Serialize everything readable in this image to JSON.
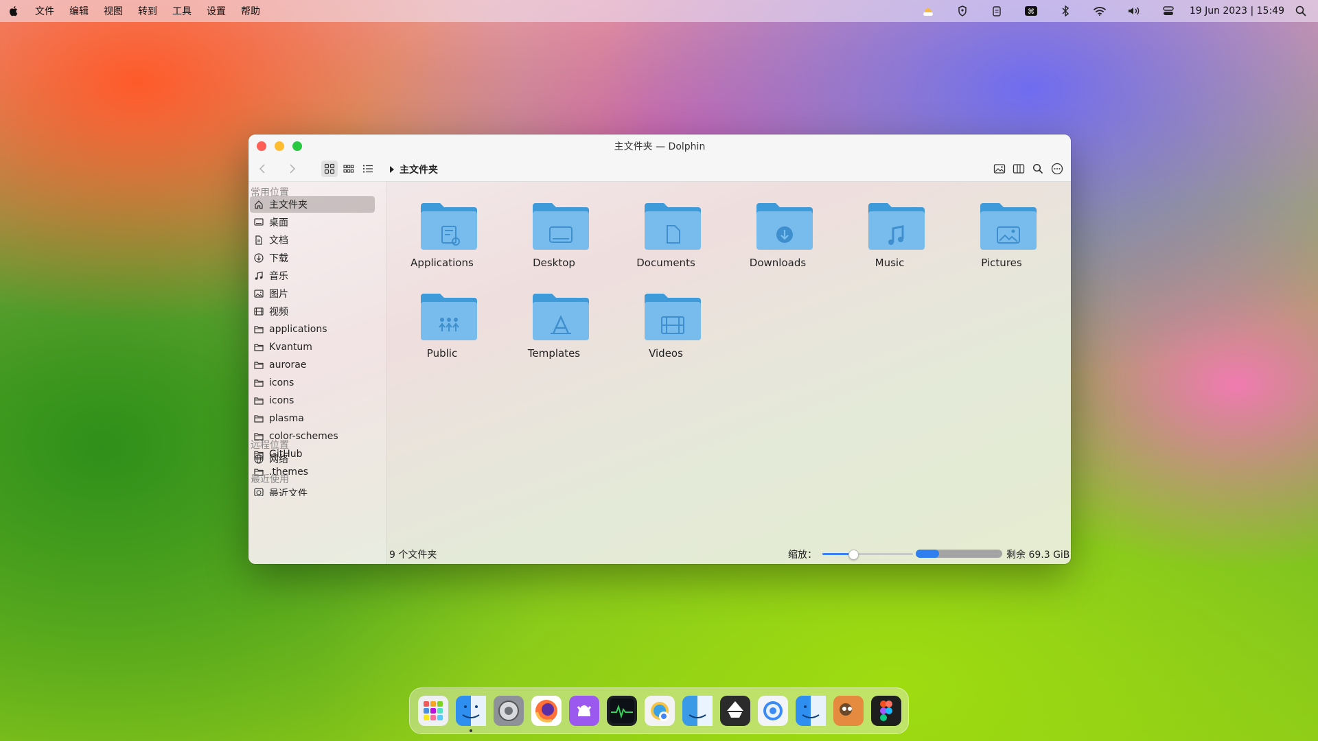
{
  "menubar": {
    "items": [
      "文件",
      "编辑",
      "视图",
      "转到",
      "工具",
      "设置",
      "帮助"
    ],
    "clock": "19 Jun 2023 | 15:49",
    "tray_icons": [
      "weather-icon",
      "vpn-shield-icon",
      "clipboard-icon",
      "keyboard-shortcut-icon",
      "bluetooth-icon",
      "wifi-icon",
      "volume-icon",
      "control-center-icon",
      "spotlight-search-icon"
    ]
  },
  "window": {
    "title": "主文件夹 — Dolphin",
    "breadcrumb": "主文件夹",
    "colors": {
      "close": "#ff5f57",
      "minimize": "#febc2e",
      "zoom": "#28c840",
      "folder": "#5aaee8"
    }
  },
  "sidebar": {
    "sections": [
      {
        "label": "常用位置"
      },
      {
        "label": "远程位置"
      },
      {
        "label": "最近使用"
      }
    ],
    "places": [
      {
        "label": "主文件夹",
        "icon": "home-icon",
        "selected": true
      },
      {
        "label": "桌面",
        "icon": "desktop-icon"
      },
      {
        "label": "文档",
        "icon": "document-icon"
      },
      {
        "label": "下载",
        "icon": "download-icon"
      },
      {
        "label": "音乐",
        "icon": "music-icon"
      },
      {
        "label": "图片",
        "icon": "picture-icon"
      },
      {
        "label": "视频",
        "icon": "video-icon"
      },
      {
        "label": "applications",
        "icon": "folder-icon"
      },
      {
        "label": "Kvantum",
        "icon": "folder-icon"
      },
      {
        "label": "aurorae",
        "icon": "folder-icon"
      },
      {
        "label": "icons",
        "icon": "folder-icon"
      },
      {
        "label": "icons",
        "icon": "folder-icon"
      },
      {
        "label": "plasma",
        "icon": "folder-icon"
      },
      {
        "label": "color-schemes",
        "icon": "folder-icon"
      },
      {
        "label": "GitHub",
        "icon": "folder-icon"
      },
      {
        "label": ".themes",
        "icon": "folder-icon"
      }
    ],
    "remote": [
      {
        "label": "网络",
        "icon": "network-icon"
      }
    ],
    "recent": [
      {
        "label": "最近文件",
        "icon": "recent-files-icon"
      }
    ]
  },
  "folders": [
    {
      "label": "Applications",
      "glyph": "applications"
    },
    {
      "label": "Desktop",
      "glyph": "desktop"
    },
    {
      "label": "Documents",
      "glyph": "documents"
    },
    {
      "label": "Downloads",
      "glyph": "downloads"
    },
    {
      "label": "Music",
      "glyph": "music"
    },
    {
      "label": "Pictures",
      "glyph": "pictures"
    },
    {
      "label": "Public",
      "glyph": "public"
    },
    {
      "label": "Templates",
      "glyph": "templates"
    },
    {
      "label": "Videos",
      "glyph": "videos"
    }
  ],
  "status": {
    "count": "9 个文件夹",
    "zoom_label": "缩放：",
    "zoom_value": 0.33,
    "free_space": "剩余 69.3 GiB",
    "used_fraction": 0.27
  },
  "dock": {
    "apps": [
      {
        "name": "launchpad-icon",
        "running": false
      },
      {
        "name": "finder-icon",
        "running": true
      },
      {
        "name": "system-settings-icon",
        "running": false
      },
      {
        "name": "firefox-icon",
        "running": false
      },
      {
        "name": "github-desktop-icon",
        "running": false
      },
      {
        "name": "activity-monitor-icon",
        "running": false
      },
      {
        "name": "photos-chrome-icon",
        "running": false
      },
      {
        "name": "finder-alt-icon",
        "running": false
      },
      {
        "name": "inkscape-icon",
        "running": false
      },
      {
        "name": "safari-icon",
        "running": false
      },
      {
        "name": "finder-alt2-icon",
        "running": false
      },
      {
        "name": "gimp-icon",
        "running": false
      },
      {
        "name": "figma-icon",
        "running": false
      }
    ]
  }
}
